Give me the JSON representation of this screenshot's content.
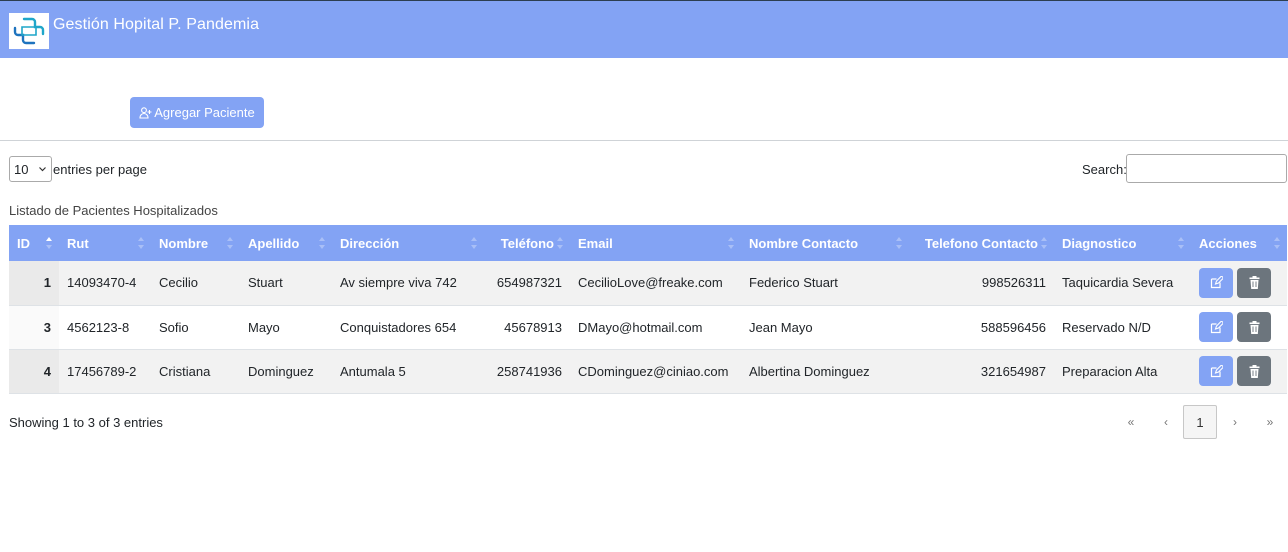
{
  "header": {
    "title": "Gestión Hopital P. Pandemia",
    "logo_icon": "hospital-cross-icon",
    "color": "#83a3f4"
  },
  "toolbar": {
    "add_label": "Agregar Paciente",
    "add_icon": "user-plus-icon"
  },
  "table_controls": {
    "page_size": "10",
    "entries_label": "entries per page",
    "search_label": "Search:",
    "search_value": ""
  },
  "table": {
    "caption": "Listado de Pacientes Hospitalizados",
    "columns": [
      "ID",
      "Rut",
      "Nombre",
      "Apellido",
      "Dirección",
      "Teléfono",
      "Email",
      "Nombre Contacto",
      "Telefono Contacto",
      "Diagnostico",
      "Acciones"
    ],
    "rows": [
      {
        "id": "1",
        "rut": "14093470-4",
        "nombre": "Cecilio",
        "apellido": "Stuart",
        "direccion": "Av siempre viva 742",
        "telefono": "654987321",
        "email": "CecilioLove@freake.com",
        "contacto": "Federico Stuart",
        "telefono_contacto": "998526311",
        "diagnostico": "Taquicardia Severa"
      },
      {
        "id": "3",
        "rut": "4562123-8",
        "nombre": "Sofio",
        "apellido": "Mayo",
        "direccion": "Conquistadores 654",
        "telefono": "45678913",
        "email": "DMayo@hotmail.com",
        "contacto": "Jean Mayo",
        "telefono_contacto": "588596456",
        "diagnostico": "Reservado N/D"
      },
      {
        "id": "4",
        "rut": "17456789-2",
        "nombre": "Cristiana",
        "apellido": "Dominguez",
        "direccion": "Antumala 5",
        "telefono": "258741936",
        "email": "CDominguez@ciniao.com",
        "contacto": "Albertina Dominguez",
        "telefono_contacto": "321654987",
        "diagnostico": "Preparacion Alta"
      }
    ],
    "action_icons": {
      "edit": "edit-icon",
      "delete": "trash-icon"
    }
  },
  "footer": {
    "info": "Showing 1 to 3 of 3 entries",
    "pagination": {
      "first": "«",
      "prev": "‹",
      "current": "1",
      "next": "›",
      "last": "»"
    }
  }
}
